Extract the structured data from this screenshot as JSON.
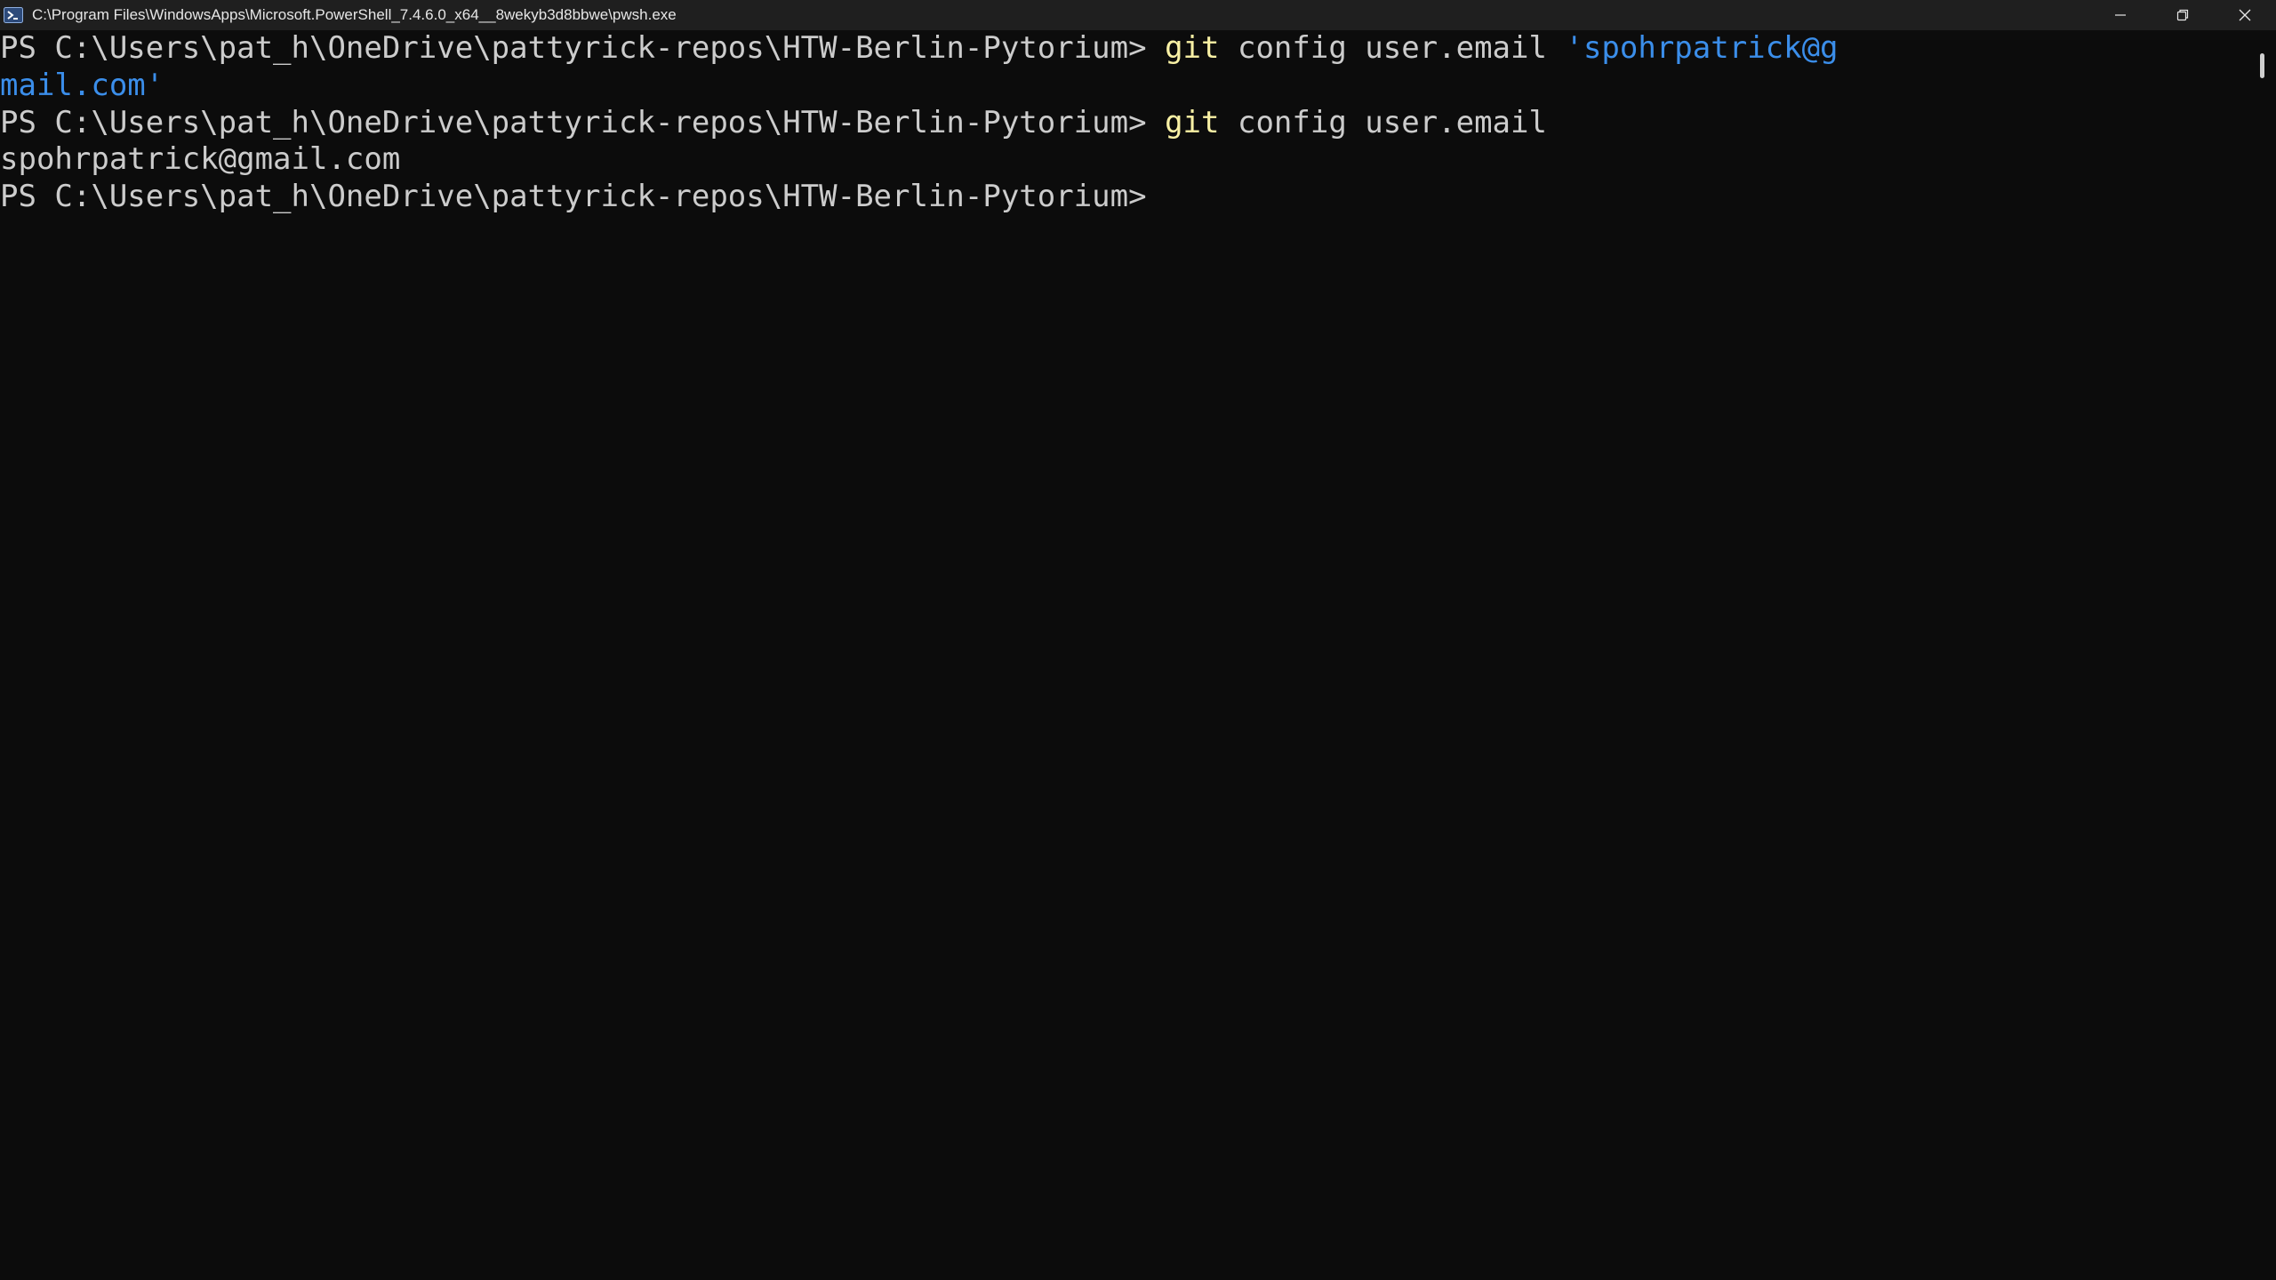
{
  "window": {
    "title": "C:\\Program Files\\WindowsApps\\Microsoft.PowerShell_7.4.6.0_x64__8wekyb3d8bbwe\\pwsh.exe",
    "app_icon": "powershell-icon",
    "controls": [
      "minimize-icon",
      "restore-icon",
      "close-icon"
    ]
  },
  "terminal": {
    "prompt": "PS C:\\Users\\pat_h\\OneDrive\\pattyrick-repos\\HTW-Berlin-Pytorium>",
    "line1": {
      "cmd": "git",
      "args": "config user.email",
      "string_part1": "'spohrpatrick@g"
    },
    "line2": {
      "string_part2": "mail.com'"
    },
    "line3": {
      "cmd": "git",
      "args": "config user.email"
    },
    "line4": {
      "output": "spohrpatrick@gmail.com"
    }
  },
  "colors": {
    "background": "#0c0c0c",
    "titlebar": "#1f1f1f",
    "text": "#cccccc",
    "command": "#f9f1a5",
    "string": "#3b8eea"
  }
}
